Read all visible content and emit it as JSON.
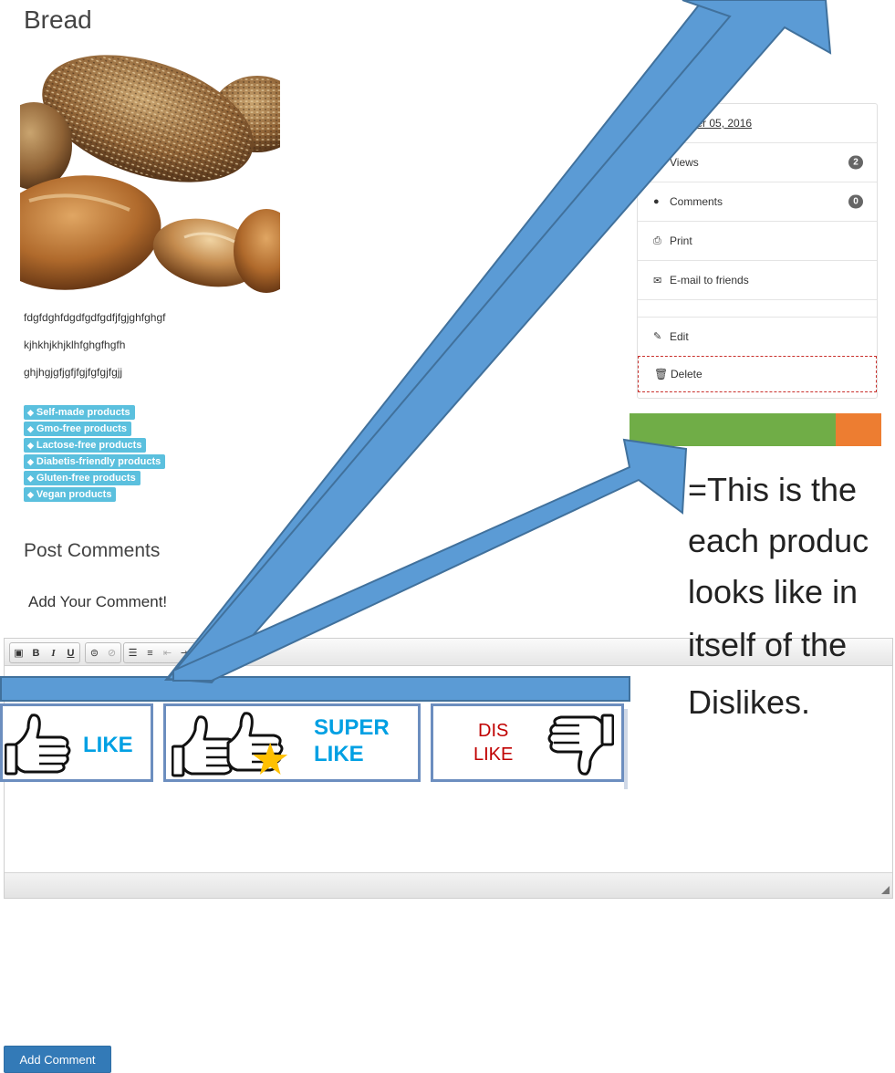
{
  "product": {
    "title": "Bread",
    "description_lines": [
      "fdgfdghfdgdfgdfgdfjfgjghfghgf",
      "kjhkhjkhjklhfghgfhgfh",
      "ghjhgjgfjgfjfgjfgfgjfgjj"
    ],
    "tags": [
      "Self-made products",
      "Gmo-free products",
      "Lactose-free products",
      "Diabetis-friendly products",
      "Gluten-free products",
      "Vegan products"
    ],
    "tag_icon": "tag-icon"
  },
  "comments": {
    "section_title": "Post Comments",
    "add_prompt": "Add Your Comment!",
    "add_button_label": "Add Comment",
    "editor_toolbar": [
      "image",
      "bold",
      "italic",
      "underline",
      "link",
      "unlink",
      "ordered-list",
      "unordered-list",
      "outdent",
      "indent",
      "quote"
    ]
  },
  "sidebar": {
    "date": "vember 05, 2016",
    "views_label": "Views",
    "views_count": "2",
    "comments_label": "Comments",
    "comments_count": "0",
    "print_label": "Print",
    "email_label": "E-mail to friends",
    "edit_label": "Edit",
    "delete_label": "Delete"
  },
  "vote_bar": {
    "likes_fraction": 0.82,
    "dislikes_fraction": 0.18,
    "colors": {
      "like": "#70ad47",
      "dislike": "#ed7d31"
    }
  },
  "annotation": {
    "lines": [
      "=This is the",
      "each produc",
      "looks like in",
      "itself of the",
      "Dislikes."
    ]
  },
  "reactions": {
    "like": "LIKE",
    "super_like_top": "SUPER",
    "super_like_bottom": "LIKE",
    "dislike_top": "DIS",
    "dislike_bottom": "LIKE"
  },
  "colors": {
    "tag": "#5bc0de",
    "button": "#337ab7",
    "arrow": "#5b9bd5",
    "like_text": "#00a0e3",
    "dislike_text": "#c00000"
  }
}
